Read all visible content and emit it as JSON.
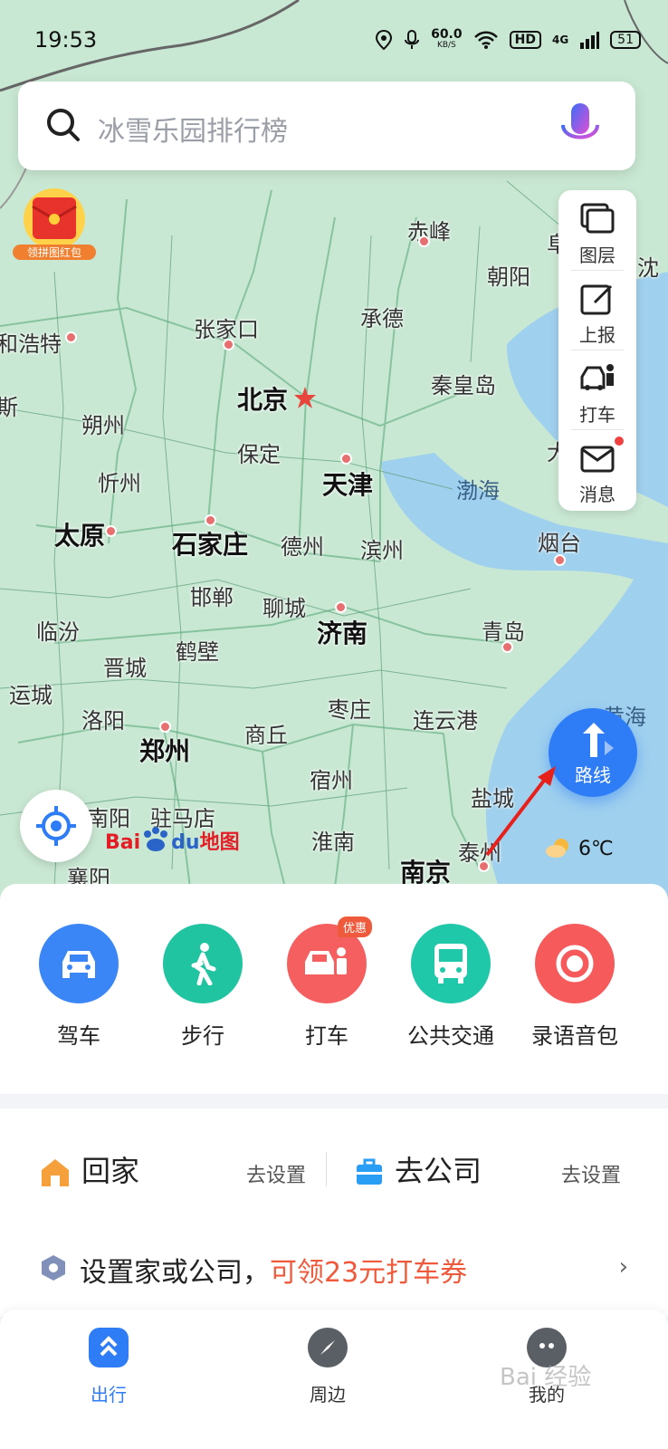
{
  "status": {
    "time": "19:53",
    "speed": "60.0",
    "speed_unit": "KB/S",
    "hd": "HD",
    "net": "4G",
    "battery": "51"
  },
  "search": {
    "placeholder": "冰雪乐园排行榜"
  },
  "red_packet": {
    "label": "领拼图红包"
  },
  "tools": [
    {
      "label": "图层",
      "icon": "layers-icon"
    },
    {
      "label": "上报",
      "icon": "report-edit-icon"
    },
    {
      "label": "打车",
      "icon": "taxi-icon"
    },
    {
      "label": "消息",
      "icon": "message-icon"
    }
  ],
  "map": {
    "cities": [
      "赤峰",
      "朝阳",
      "和浩特",
      "张家口",
      "承德",
      "北京",
      "秦皇岛",
      "朔州",
      "保定",
      "天津",
      "忻州",
      "太原",
      "石家庄",
      "德州",
      "滨州",
      "渤海",
      "烟台",
      "邯郸",
      "聊城",
      "济南",
      "临汾",
      "鹤壁",
      "晋城",
      "青岛",
      "运城",
      "洛阳",
      "枣庄",
      "商丘",
      "连云港",
      "郑州",
      "宿州",
      "盐城",
      "黄海",
      "南阳",
      "驻马店",
      "淮南",
      "泰州",
      "南京",
      "襄阳",
      "沈",
      "斯",
      "大",
      "阜"
    ]
  },
  "route_button": {
    "label": "路线"
  },
  "logo": {
    "part1": "Bai",
    "part2": "du",
    "part3": "地图"
  },
  "weather": {
    "temp": "6℃"
  },
  "modes": [
    {
      "label": "驾车",
      "color": "#3a86f7"
    },
    {
      "label": "步行",
      "color": "#20c4a0"
    },
    {
      "label": "打车",
      "color": "#f65f5f",
      "tag": "优惠"
    },
    {
      "label": "公共交通",
      "color": "#1ec8a8"
    },
    {
      "label": "录语音包",
      "color": "#f65a5a"
    }
  ],
  "quick": {
    "home_label": "回家",
    "home_action": "去设置",
    "work_label": "去公司",
    "work_action": "去设置",
    "promo_text": "设置家或公司，",
    "promo_highlight": "可领23元打车券"
  },
  "tabs": [
    {
      "label": "出行",
      "active": true
    },
    {
      "label": "周边"
    },
    {
      "label": "我的"
    }
  ],
  "watermark": "Bai 经验"
}
